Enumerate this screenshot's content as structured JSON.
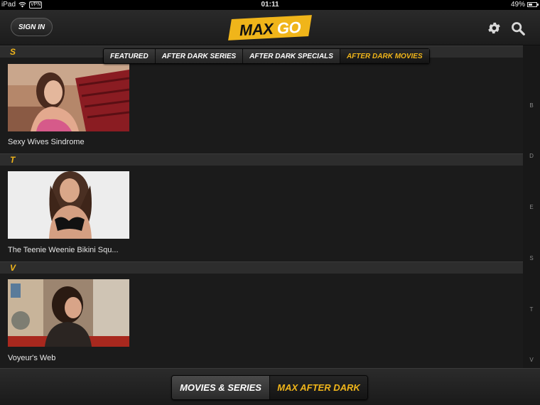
{
  "status_bar": {
    "device": "iPad",
    "vpn": "VPN",
    "time": "01:11",
    "battery": "49%",
    "battery_level": 0.49
  },
  "header": {
    "sign_in_label": "SIGN IN",
    "logo_max": "MAX",
    "logo_go": "GO",
    "logo_color": "#f0b51a"
  },
  "tabs": [
    {
      "label": "FEATURED",
      "active": false
    },
    {
      "label": "AFTER DARK SERIES",
      "active": false
    },
    {
      "label": "AFTER DARK SPECIALS",
      "active": false
    },
    {
      "label": "AFTER DARK MOVIES",
      "active": true
    }
  ],
  "sections": [
    {
      "letter": "S",
      "items": [
        {
          "title": "Sexy Wives Sindrome"
        }
      ]
    },
    {
      "letter": "T",
      "items": [
        {
          "title": "The Teenie Weenie Bikini Squ..."
        }
      ]
    },
    {
      "letter": "V",
      "items": [
        {
          "title": "Voyeur's Web"
        }
      ]
    }
  ],
  "index_letters": [
    "B",
    "D",
    "E",
    "S",
    "T",
    "V"
  ],
  "bottom_nav": {
    "left_label": "MOVIES & SERIES",
    "right_label": "MAX AFTER DARK",
    "active": "right"
  },
  "colors": {
    "accent": "#f0b51a",
    "background": "#1b1b1b"
  }
}
